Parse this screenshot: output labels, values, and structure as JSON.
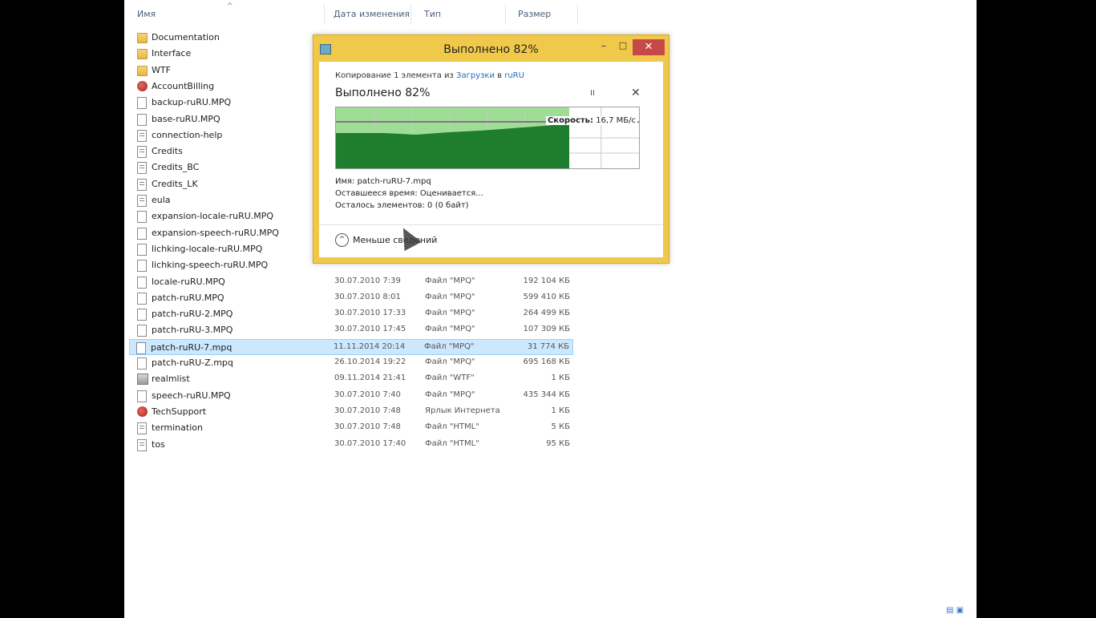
{
  "columns": {
    "name": "Имя",
    "date": "Дата изменения",
    "type": "Тип",
    "size": "Размер"
  },
  "files": [
    {
      "icon": "folder-icon",
      "name": "Documentation",
      "date": "",
      "type": "",
      "size": ""
    },
    {
      "icon": "folder-icon",
      "name": "Interface",
      "date": "",
      "type": "",
      "size": ""
    },
    {
      "icon": "folder-icon",
      "name": "WTF",
      "date": "",
      "type": "",
      "size": ""
    },
    {
      "icon": "web-shortcut-icon",
      "name": "AccountBilling",
      "date": "",
      "type": "",
      "size": ""
    },
    {
      "icon": "file-icon",
      "name": "backup-ruRU.MPQ",
      "date": "",
      "type": "",
      "size": ""
    },
    {
      "icon": "file-icon",
      "name": "base-ruRU.MPQ",
      "date": "",
      "type": "",
      "size": ""
    },
    {
      "icon": "text-file-icon",
      "name": "connection-help",
      "date": "",
      "type": "",
      "size": ""
    },
    {
      "icon": "text-file-icon",
      "name": "Credits",
      "date": "",
      "type": "",
      "size": ""
    },
    {
      "icon": "text-file-icon",
      "name": "Credits_BC",
      "date": "",
      "type": "",
      "size": ""
    },
    {
      "icon": "text-file-icon",
      "name": "Credits_LK",
      "date": "",
      "type": "",
      "size": ""
    },
    {
      "icon": "text-file-icon",
      "name": "eula",
      "date": "",
      "type": "",
      "size": ""
    },
    {
      "icon": "file-icon",
      "name": "expansion-locale-ruRU.MPQ",
      "date": "",
      "type": "",
      "size": ""
    },
    {
      "icon": "file-icon",
      "name": "expansion-speech-ruRU.MPQ",
      "date": "",
      "type": "",
      "size": ""
    },
    {
      "icon": "file-icon",
      "name": "lichking-locale-ruRU.MPQ",
      "date": "",
      "type": "",
      "size": ""
    },
    {
      "icon": "file-icon",
      "name": "lichking-speech-ruRU.MPQ",
      "date": "",
      "type": "",
      "size": ""
    },
    {
      "icon": "file-icon",
      "name": "locale-ruRU.MPQ",
      "date": "30.07.2010 7:39",
      "type": "Файл \"MPQ\"",
      "size": "192 104 КБ"
    },
    {
      "icon": "file-icon",
      "name": "patch-ruRU.MPQ",
      "date": "30.07.2010 8:01",
      "type": "Файл \"MPQ\"",
      "size": "599 410 КБ"
    },
    {
      "icon": "file-icon",
      "name": "patch-ruRU-2.MPQ",
      "date": "30.07.2010 17:33",
      "type": "Файл \"MPQ\"",
      "size": "264 499 КБ"
    },
    {
      "icon": "file-icon",
      "name": "patch-ruRU-3.MPQ",
      "date": "30.07.2010 17:45",
      "type": "Файл \"MPQ\"",
      "size": "107 309 КБ"
    },
    {
      "icon": "file-icon",
      "name": "patch-ruRU-7.mpq",
      "date": "11.11.2014 20:14",
      "type": "Файл \"MPQ\"",
      "size": "31 774 КБ",
      "selected": true
    },
    {
      "icon": "file-icon",
      "name": "patch-ruRU-Z.mpq",
      "date": "26.10.2014 19:22",
      "type": "Файл \"MPQ\"",
      "size": "695 168 КБ"
    },
    {
      "icon": "config-file-icon",
      "name": "realmlist",
      "date": "09.11.2014 21:41",
      "type": "Файл \"WTF\"",
      "size": "1 КБ"
    },
    {
      "icon": "file-icon",
      "name": "speech-ruRU.MPQ",
      "date": "30.07.2010 7:40",
      "type": "Файл \"MPQ\"",
      "size": "435 344 КБ"
    },
    {
      "icon": "web-shortcut-icon",
      "name": "TechSupport",
      "date": "30.07.2010 7:48",
      "type": "Ярлык Интернета",
      "size": "1 КБ"
    },
    {
      "icon": "text-file-icon",
      "name": "termination",
      "date": "30.07.2010 7:48",
      "type": "Файл \"HTML\"",
      "size": "5 КБ"
    },
    {
      "icon": "text-file-icon",
      "name": "tos",
      "date": "30.07.2010 17:40",
      "type": "Файл \"HTML\"",
      "size": "95 КБ"
    }
  ],
  "dialog": {
    "title": "Выполнено 82%",
    "minimize_glyph": "–",
    "maximize_glyph": "□",
    "close_glyph": "✕",
    "copy_prefix": "Копирование 1 элемента из ",
    "copy_source": "Загрузки",
    "copy_middle": " в ",
    "copy_dest": "ruRU",
    "status": "Выполнено 82%",
    "pause_glyph": "II",
    "cancel_glyph": "✕",
    "progress": 0.82,
    "speed_label": "Скорость:",
    "speed_value": " 16,7 МБ/с",
    "name_line": "Имя:  patch-ruRU-7.mpq",
    "time_line": "Оставшееся время:  Оценивается...",
    "items_line": "Осталось элементов:  0 (0 байт)",
    "less_details_label": "Меньше сведений",
    "less_details_glyph": "^"
  },
  "colors": {
    "dialog_frame": "#f1c94a",
    "close_button": "#c74848",
    "graph_fill": "#1f7d2e",
    "graph_progress_bg": "#9fdc96",
    "selected_row": "#cce8ff"
  }
}
